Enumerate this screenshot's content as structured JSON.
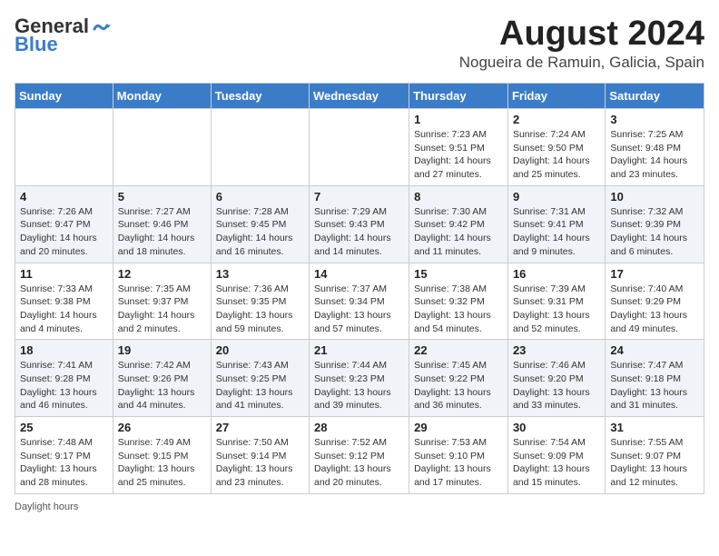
{
  "header": {
    "logo_line1": "General",
    "logo_line2": "Blue",
    "title": "August 2024",
    "subtitle": "Nogueira de Ramuin, Galicia, Spain"
  },
  "columns": [
    "Sunday",
    "Monday",
    "Tuesday",
    "Wednesday",
    "Thursday",
    "Friday",
    "Saturday"
  ],
  "weeks": [
    [
      {
        "day": "",
        "detail": ""
      },
      {
        "day": "",
        "detail": ""
      },
      {
        "day": "",
        "detail": ""
      },
      {
        "day": "",
        "detail": ""
      },
      {
        "day": "1",
        "detail": "Sunrise: 7:23 AM\nSunset: 9:51 PM\nDaylight: 14 hours\nand 27 minutes."
      },
      {
        "day": "2",
        "detail": "Sunrise: 7:24 AM\nSunset: 9:50 PM\nDaylight: 14 hours\nand 25 minutes."
      },
      {
        "day": "3",
        "detail": "Sunrise: 7:25 AM\nSunset: 9:48 PM\nDaylight: 14 hours\nand 23 minutes."
      }
    ],
    [
      {
        "day": "4",
        "detail": "Sunrise: 7:26 AM\nSunset: 9:47 PM\nDaylight: 14 hours\nand 20 minutes."
      },
      {
        "day": "5",
        "detail": "Sunrise: 7:27 AM\nSunset: 9:46 PM\nDaylight: 14 hours\nand 18 minutes."
      },
      {
        "day": "6",
        "detail": "Sunrise: 7:28 AM\nSunset: 9:45 PM\nDaylight: 14 hours\nand 16 minutes."
      },
      {
        "day": "7",
        "detail": "Sunrise: 7:29 AM\nSunset: 9:43 PM\nDaylight: 14 hours\nand 14 minutes."
      },
      {
        "day": "8",
        "detail": "Sunrise: 7:30 AM\nSunset: 9:42 PM\nDaylight: 14 hours\nand 11 minutes."
      },
      {
        "day": "9",
        "detail": "Sunrise: 7:31 AM\nSunset: 9:41 PM\nDaylight: 14 hours\nand 9 minutes."
      },
      {
        "day": "10",
        "detail": "Sunrise: 7:32 AM\nSunset: 9:39 PM\nDaylight: 14 hours\nand 6 minutes."
      }
    ],
    [
      {
        "day": "11",
        "detail": "Sunrise: 7:33 AM\nSunset: 9:38 PM\nDaylight: 14 hours\nand 4 minutes."
      },
      {
        "day": "12",
        "detail": "Sunrise: 7:35 AM\nSunset: 9:37 PM\nDaylight: 14 hours\nand 2 minutes."
      },
      {
        "day": "13",
        "detail": "Sunrise: 7:36 AM\nSunset: 9:35 PM\nDaylight: 13 hours\nand 59 minutes."
      },
      {
        "day": "14",
        "detail": "Sunrise: 7:37 AM\nSunset: 9:34 PM\nDaylight: 13 hours\nand 57 minutes."
      },
      {
        "day": "15",
        "detail": "Sunrise: 7:38 AM\nSunset: 9:32 PM\nDaylight: 13 hours\nand 54 minutes."
      },
      {
        "day": "16",
        "detail": "Sunrise: 7:39 AM\nSunset: 9:31 PM\nDaylight: 13 hours\nand 52 minutes."
      },
      {
        "day": "17",
        "detail": "Sunrise: 7:40 AM\nSunset: 9:29 PM\nDaylight: 13 hours\nand 49 minutes."
      }
    ],
    [
      {
        "day": "18",
        "detail": "Sunrise: 7:41 AM\nSunset: 9:28 PM\nDaylight: 13 hours\nand 46 minutes."
      },
      {
        "day": "19",
        "detail": "Sunrise: 7:42 AM\nSunset: 9:26 PM\nDaylight: 13 hours\nand 44 minutes."
      },
      {
        "day": "20",
        "detail": "Sunrise: 7:43 AM\nSunset: 9:25 PM\nDaylight: 13 hours\nand 41 minutes."
      },
      {
        "day": "21",
        "detail": "Sunrise: 7:44 AM\nSunset: 9:23 PM\nDaylight: 13 hours\nand 39 minutes."
      },
      {
        "day": "22",
        "detail": "Sunrise: 7:45 AM\nSunset: 9:22 PM\nDaylight: 13 hours\nand 36 minutes."
      },
      {
        "day": "23",
        "detail": "Sunrise: 7:46 AM\nSunset: 9:20 PM\nDaylight: 13 hours\nand 33 minutes."
      },
      {
        "day": "24",
        "detail": "Sunrise: 7:47 AM\nSunset: 9:18 PM\nDaylight: 13 hours\nand 31 minutes."
      }
    ],
    [
      {
        "day": "25",
        "detail": "Sunrise: 7:48 AM\nSunset: 9:17 PM\nDaylight: 13 hours\nand 28 minutes."
      },
      {
        "day": "26",
        "detail": "Sunrise: 7:49 AM\nSunset: 9:15 PM\nDaylight: 13 hours\nand 25 minutes."
      },
      {
        "day": "27",
        "detail": "Sunrise: 7:50 AM\nSunset: 9:14 PM\nDaylight: 13 hours\nand 23 minutes."
      },
      {
        "day": "28",
        "detail": "Sunrise: 7:52 AM\nSunset: 9:12 PM\nDaylight: 13 hours\nand 20 minutes."
      },
      {
        "day": "29",
        "detail": "Sunrise: 7:53 AM\nSunset: 9:10 PM\nDaylight: 13 hours\nand 17 minutes."
      },
      {
        "day": "30",
        "detail": "Sunrise: 7:54 AM\nSunset: 9:09 PM\nDaylight: 13 hours\nand 15 minutes."
      },
      {
        "day": "31",
        "detail": "Sunrise: 7:55 AM\nSunset: 9:07 PM\nDaylight: 13 hours\nand 12 minutes."
      }
    ]
  ],
  "footer": {
    "daylight_label": "Daylight hours"
  },
  "colors": {
    "header_bg": "#3b7cc9",
    "logo_blue": "#4a90d9"
  }
}
